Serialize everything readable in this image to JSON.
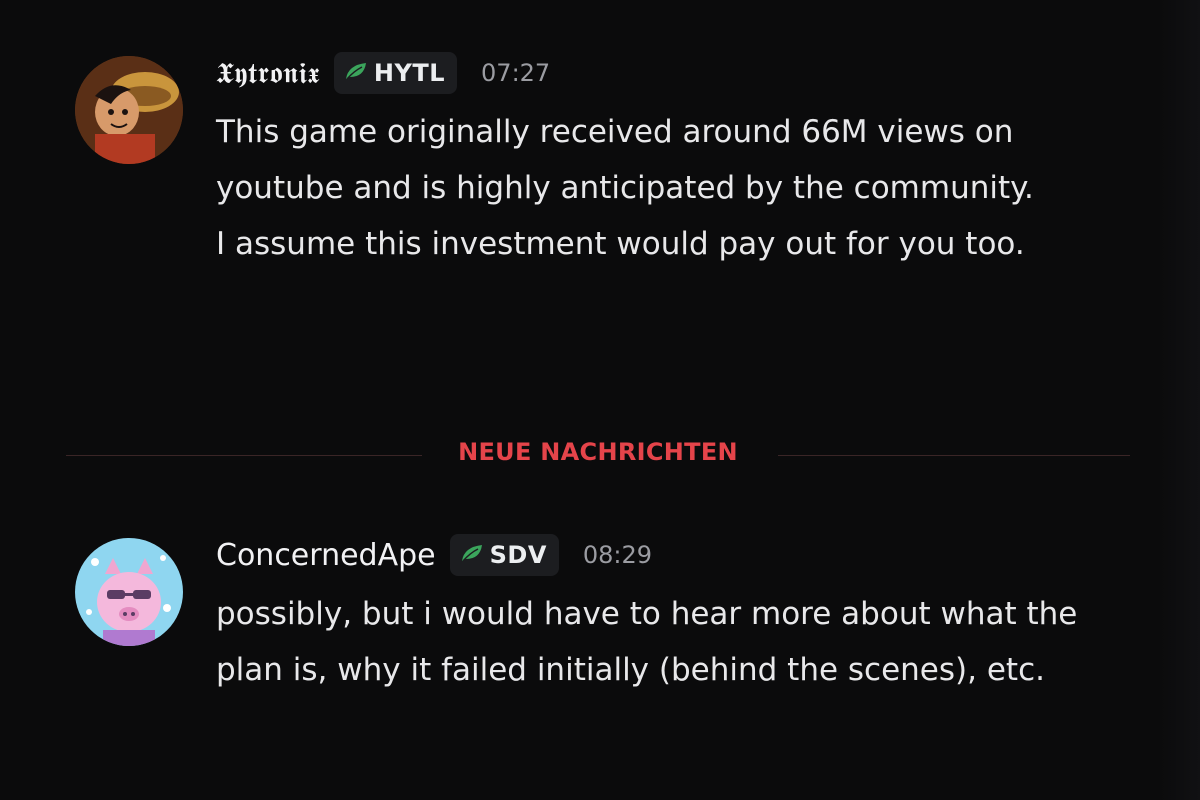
{
  "messages": [
    {
      "username": "𝖃𝖞𝖙𝖗𝖔𝖓𝖎𝖝",
      "tag": "HYTL",
      "time": "07:27",
      "lines": [
        "This game originally received around 66M views on youtube and is highly anticipated by the community.",
        "I assume this investment would pay out for you too."
      ],
      "avatar": "anime-character-avatar"
    },
    {
      "username": "ConcernedApe",
      "tag": "SDV",
      "time": "08:29",
      "lines": [
        "possibly, but i would have to hear more about what the plan is, why it failed initially (behind the scenes), etc."
      ],
      "avatar": "pink-pig-avatar"
    }
  ],
  "divider": {
    "label": "NEUE NACHRICHTEN",
    "color": "#e5444a"
  },
  "colors": {
    "background": "#0b0b0c",
    "tag_leaf": "#3ba55c",
    "tag_bg": "#1c1d20"
  }
}
